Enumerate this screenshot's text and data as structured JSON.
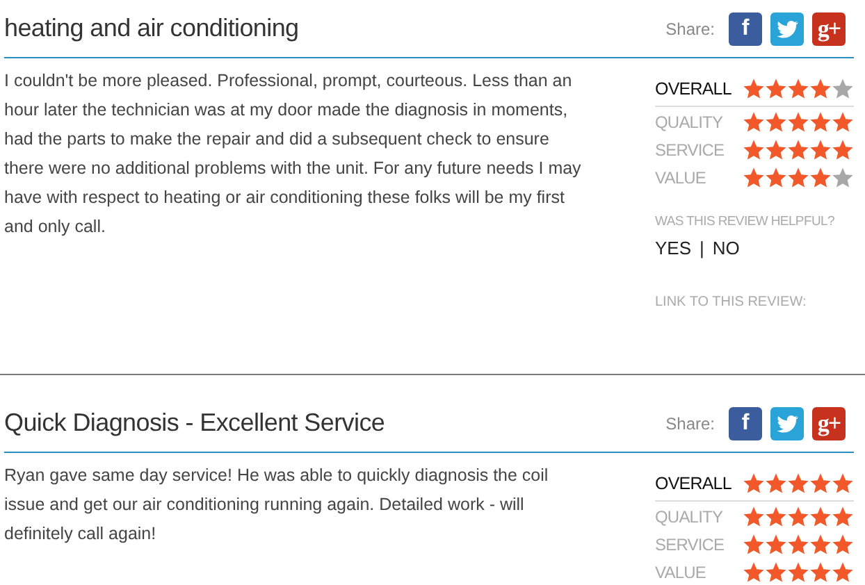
{
  "reviews": [
    {
      "title": "heating and air conditioning",
      "share_label": "Share:",
      "share_buttons": [
        {
          "kind": "facebook",
          "glyph": "f"
        },
        {
          "kind": "twitter"
        },
        {
          "kind": "googleplus",
          "glyph": "g+"
        }
      ],
      "body": "I couldn't be more pleased. Professional, prompt, courteous. Less than an hour later the technician was at my door made the diagnosis in moments, had the parts to make the repair and did a subsequent check to ensure there were no additional problems with the unit. For any future needs I may have with respect to heating or air conditioning these folks will be my first and only call.",
      "overall": {
        "label": "OVERALL",
        "stars": 4
      },
      "ratings": [
        {
          "label": "QUALITY",
          "stars": 5
        },
        {
          "label": "SERVICE",
          "stars": 5
        },
        {
          "label": "VALUE",
          "stars": 4
        }
      ],
      "helpful_prompt": "WAS THIS REVIEW HELPFUL?",
      "yes": "YES",
      "separator": "|",
      "no": "NO",
      "link_label": "LINK TO THIS REVIEW:"
    },
    {
      "title": "Quick Diagnosis - Excellent Service",
      "share_label": "Share:",
      "share_buttons": [
        {
          "kind": "facebook",
          "glyph": "f"
        },
        {
          "kind": "twitter"
        },
        {
          "kind": "googleplus",
          "glyph": "g+"
        }
      ],
      "body": "Ryan gave same day service! He was able to quickly diagnosis the coil issue and get our air conditioning running again. Detailed work - will definitely call again!",
      "overall": {
        "label": "OVERALL",
        "stars": 5
      },
      "ratings": [
        {
          "label": "QUALITY",
          "stars": 5
        },
        {
          "label": "SERVICE",
          "stars": 5
        },
        {
          "label": "VALUE",
          "stars": 5
        }
      ]
    }
  ]
}
